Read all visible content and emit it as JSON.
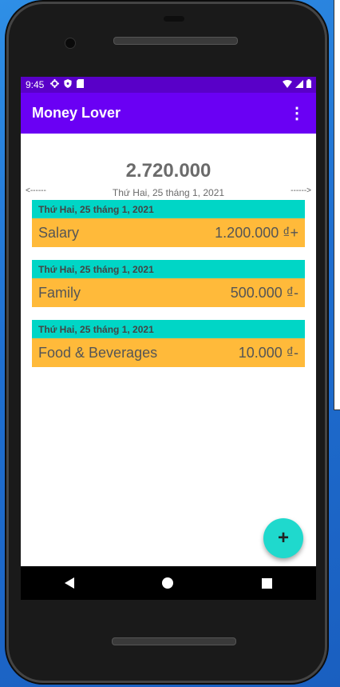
{
  "statusbar": {
    "time": "9:45"
  },
  "appbar": {
    "title": "Money Lover",
    "menu_icon": "⋮"
  },
  "summary": {
    "total": "2.720.000",
    "date": "Thứ Hai, 25 tháng 1, 2021",
    "prev_arrow": "<------",
    "next_arrow": "------>"
  },
  "transactions": [
    {
      "date": "Thứ Hai, 25 tháng 1, 2021",
      "category": "Salary",
      "amount": "1.200.000 ₫+"
    },
    {
      "date": "Thứ Hai, 25 tháng 1, 2021",
      "category": "Family",
      "amount": "500.000 ₫-"
    },
    {
      "date": "Thứ Hai, 25 tháng 1, 2021",
      "category": "Food & Beverages",
      "amount": "10.000 ₫-"
    }
  ],
  "fab": {
    "label": "+"
  },
  "colors": {
    "appbar": "#6a00f4",
    "statusbar": "#5900c8",
    "date_header": "#00d6c6",
    "item_body": "#ffba3a",
    "fab": "#1fd9cd"
  }
}
